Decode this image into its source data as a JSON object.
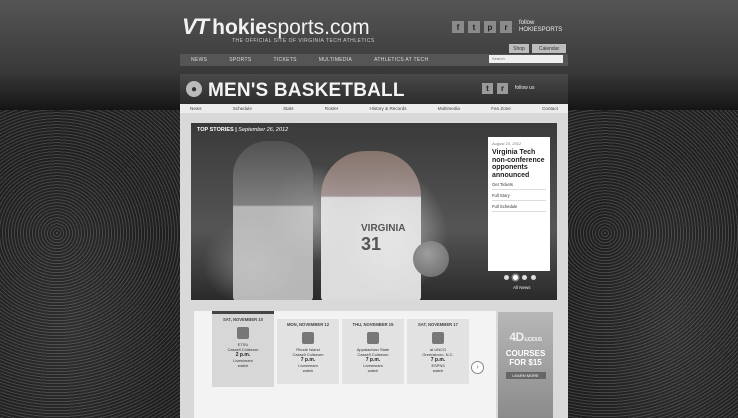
{
  "header": {
    "logo_vt": "VT",
    "logo_site_bold": "hokie",
    "logo_site_light": "sports.com",
    "tagline": "THE OFFICIAL SITE OF VIRGINIA TECH ATHLETICS",
    "social_icons": [
      "facebook-icon",
      "twitter-icon",
      "pinterest-icon",
      "rss-icon"
    ],
    "follow_text": "follow HOKIESPORTS",
    "tab_shop": "Shop",
    "tab_calendar": "Calendar",
    "nav": [
      "NEWS",
      "SPORTS",
      "TICKETS",
      "MULTIMEDIA",
      "ATHLETICS AT TECH"
    ],
    "search_placeholder": "Search"
  },
  "sport": {
    "title": "MEN'S BASKETBALL",
    "follow_text": "follow us",
    "subnav": [
      "News",
      "Schedule",
      "Stats",
      "Roster",
      "History & Records",
      "Multimedia",
      "Fan Zone",
      "Contact"
    ]
  },
  "hero": {
    "label": "TOP STORIES",
    "date": "September 26, 2012",
    "jersey_text": "VIRGINIA",
    "jersey_number": "31",
    "story": {
      "date": "August 23, 2012",
      "headline": "Virginia Tech non-conference opponents announced",
      "links": [
        "Get Tickets",
        "Full Story",
        "Full Schedule"
      ]
    },
    "all_news": "All News"
  },
  "schedule": [
    {
      "day": "SAT, NOVEMBER 10",
      "opponent": "ETSU",
      "venue": "Cassell Coliseum",
      "time": "2 p.m.",
      "tv": "Livestream",
      "extra": "watch"
    },
    {
      "day": "MON, NOVEMBER 12",
      "opponent": "Rhode Island",
      "venue": "Cassell Coliseum",
      "time": "7 p.m.",
      "tv": "Livestream",
      "extra": "watch"
    },
    {
      "day": "THU, NOVEMBER 15",
      "opponent": "Appalachian State",
      "venue": "Cassell Coliseum",
      "time": "7 p.m.",
      "tv": "Livestream",
      "extra": "watch"
    },
    {
      "day": "SAT, NOVEMBER 17",
      "opponent": "at UNCG",
      "venue": "Greensboro, N.C.",
      "time": "7 p.m.",
      "tv": "ESPN3",
      "extra": "watch"
    }
  ],
  "ad": {
    "title": "4D",
    "title_suffix": "-LICIOUS",
    "text": "COURSES FOR $15",
    "button": "LEARN MORE"
  }
}
